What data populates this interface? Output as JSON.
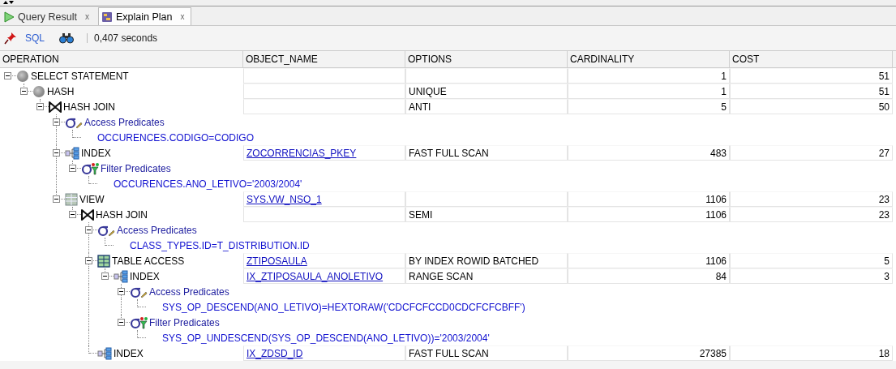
{
  "tabs": [
    {
      "label": "Query Result",
      "kind": "result",
      "selected": false,
      "close_glyph": "x"
    },
    {
      "label": "Explain Plan",
      "kind": "plan",
      "selected": true,
      "close_glyph": "x"
    }
  ],
  "toolbar": {
    "sql_label": "SQL",
    "elapsed": "0,407 seconds"
  },
  "columns": [
    "OPERATION",
    "OBJECT_NAME",
    "OPTIONS",
    "CARDINALITY",
    "COST"
  ],
  "plan": [
    {
      "kind": "select",
      "label": "SELECT STATEMENT",
      "cardinality": "1",
      "cost": "51",
      "expanded": true,
      "children": [
        {
          "kind": "hash",
          "label": "HASH",
          "options": "UNIQUE",
          "cardinality": "1",
          "cost": "51",
          "expanded": true,
          "children": [
            {
              "kind": "hash-join",
              "label": "HASH JOIN",
              "options": "ANTI",
              "cardinality": "5",
              "cost": "50",
              "expanded": true,
              "children": [
                {
                  "kind": "access",
                  "label": "Access Predicates",
                  "expanded": true,
                  "children": [
                    {
                      "kind": "predicate",
                      "label": "OCCURENCES.CODIGO=CODIGO"
                    }
                  ]
                },
                {
                  "kind": "index",
                  "label": "INDEX",
                  "object_name": "ZOCORRENCIAS_PKEY",
                  "options": "FAST FULL SCAN",
                  "cardinality": "483",
                  "cost": "27",
                  "expanded": true,
                  "children": [
                    {
                      "kind": "filter",
                      "label": "Filter Predicates",
                      "expanded": true,
                      "children": [
                        {
                          "kind": "predicate",
                          "label": "OCCURENCES.ANO_LETIVO='2003/2004'"
                        }
                      ]
                    }
                  ]
                },
                {
                  "kind": "view",
                  "label": "VIEW",
                  "object_name": "SYS.VW_NSO_1",
                  "cardinality": "1106",
                  "cost": "23",
                  "expanded": true,
                  "children": [
                    {
                      "kind": "hash-join",
                      "label": "HASH JOIN",
                      "options": "SEMI",
                      "cardinality": "1106",
                      "cost": "23",
                      "expanded": true,
                      "children": [
                        {
                          "kind": "access",
                          "label": "Access Predicates",
                          "expanded": true,
                          "children": [
                            {
                              "kind": "predicate",
                              "label": "CLASS_TYPES.ID=T_DISTRIBUTION.ID"
                            }
                          ]
                        },
                        {
                          "kind": "table",
                          "label": "TABLE ACCESS",
                          "object_name": "ZTIPOSAULA",
                          "options": "BY INDEX ROWID BATCHED",
                          "cardinality": "1106",
                          "cost": "5",
                          "expanded": true,
                          "children": [
                            {
                              "kind": "index",
                              "label": "INDEX",
                              "object_name": "IX_ZTIPOSAULA_ANOLETIVO",
                              "options": "RANGE SCAN",
                              "cardinality": "84",
                              "cost": "3",
                              "expanded": true,
                              "children": [
                                {
                                  "kind": "access",
                                  "label": "Access Predicates",
                                  "expanded": true,
                                  "children": [
                                    {
                                      "kind": "predicate",
                                      "label": "SYS_OP_DESCEND(ANO_LETIVO)=HEXTORAW('CDCFCFCCD0CDCFCFCBFF')"
                                    }
                                  ]
                                },
                                {
                                  "kind": "filter",
                                  "label": "Filter Predicates",
                                  "expanded": true,
                                  "children": [
                                    {
                                      "kind": "predicate",
                                      "label": "SYS_OP_UNDESCEND(SYS_OP_DESCEND(ANO_LETIVO))='2003/2004'"
                                    }
                                  ]
                                }
                              ]
                            }
                          ]
                        },
                        {
                          "kind": "index",
                          "label": "INDEX",
                          "object_name": "IX_ZDSD_ID",
                          "options": "FAST FULL SCAN",
                          "cardinality": "27385",
                          "cost": "18"
                        }
                      ]
                    }
                  ]
                }
              ]
            }
          ]
        }
      ]
    }
  ]
}
